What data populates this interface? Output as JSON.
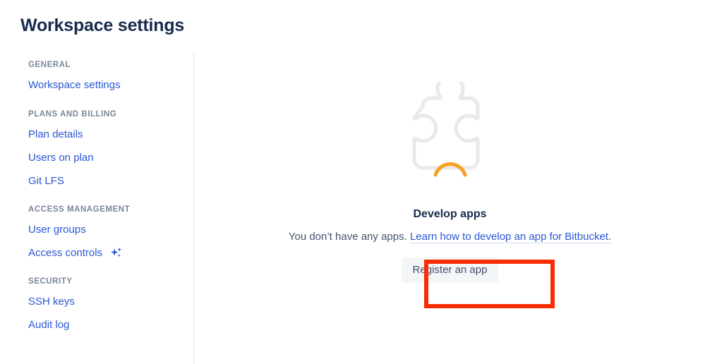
{
  "page": {
    "title": "Workspace settings"
  },
  "sidebar": {
    "groups": [
      {
        "heading": "GENERAL",
        "items": [
          {
            "label": "Workspace settings",
            "icon": null
          }
        ]
      },
      {
        "heading": "PLANS AND BILLING",
        "items": [
          {
            "label": "Plan details",
            "icon": null
          },
          {
            "label": "Users on plan",
            "icon": null
          },
          {
            "label": "Git LFS",
            "icon": null
          }
        ]
      },
      {
        "heading": "ACCESS MANAGEMENT",
        "items": [
          {
            "label": "User groups",
            "icon": null
          },
          {
            "label": "Access controls",
            "icon": "sparkle-icon"
          }
        ]
      },
      {
        "heading": "SECURITY",
        "items": [
          {
            "label": "SSH keys",
            "icon": null
          },
          {
            "label": "Audit log",
            "icon": null
          }
        ]
      }
    ]
  },
  "main": {
    "empty_state": {
      "illustration": "puzzle-piece-sad-icon",
      "heading": "Develop apps",
      "description_text": "You don’t have any apps. ",
      "description_link": "Learn how to develop an app for Bitbucket.",
      "button_label": "Register an app"
    }
  },
  "annotation": {
    "type": "highlight-rectangle",
    "target": "register-app-button",
    "color": "#F92D05"
  },
  "colors": {
    "link_blue": "#2B56D4",
    "heading_navy": "#172B4D",
    "body_slate": "#42526E",
    "muted_heading": "#7A869A",
    "button_bg": "#F4F5F7",
    "puzzle_gray": "#E9E9E9",
    "puzzle_mouth_orange": "#F5A020",
    "divider": "#E5E6E9",
    "annotation_red": "#F92D05"
  }
}
